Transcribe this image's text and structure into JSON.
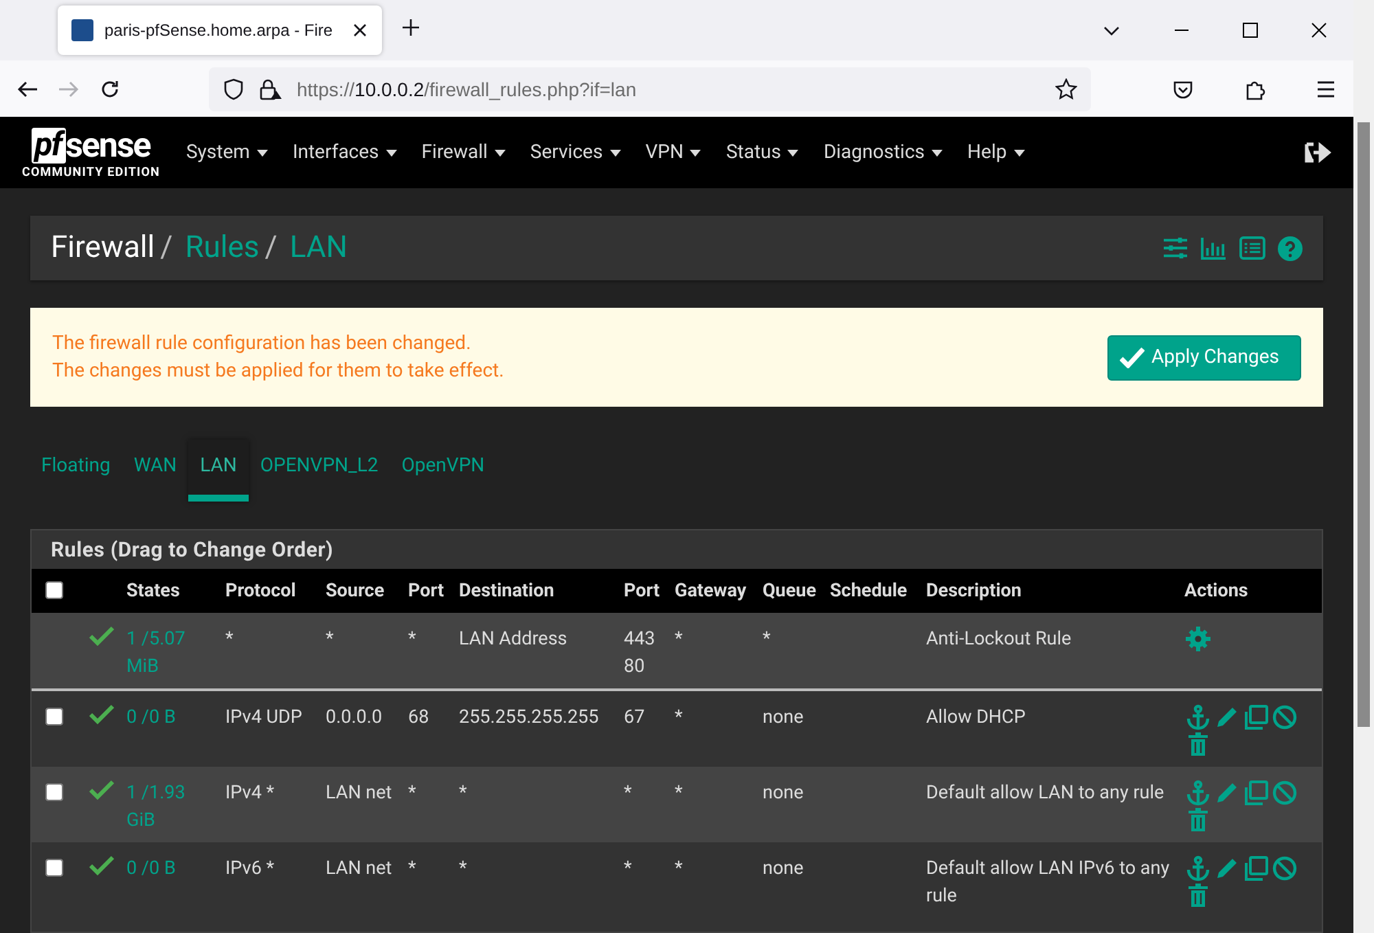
{
  "browser": {
    "tab_title": "paris-pfSense.home.arpa - Fire",
    "url": {
      "scheme": "https://",
      "host": "10.0.0.2",
      "path": "/firewall_rules.php?if=lan"
    }
  },
  "navbar": {
    "logo": {
      "mark": "pf",
      "name": "sense",
      "edition": "COMMUNITY EDITION"
    },
    "menu": [
      "System",
      "Interfaces",
      "Firewall",
      "Services",
      "VPN",
      "Status",
      "Diagnostics",
      "Help"
    ]
  },
  "breadcrumb": {
    "separator": "/",
    "items": [
      "Firewall",
      "Rules",
      "LAN"
    ]
  },
  "alert": {
    "lines": [
      "The firewall rule configuration has been changed.",
      "The changes must be applied for them to take effect."
    ],
    "button": "Apply Changes"
  },
  "tabs": [
    {
      "label": "Floating",
      "selected": false
    },
    {
      "label": "WAN",
      "selected": false
    },
    {
      "label": "LAN",
      "selected": true
    },
    {
      "label": "OPENVPN_L2",
      "selected": false
    },
    {
      "label": "OpenVPN",
      "selected": false
    }
  ],
  "rules": {
    "title": "Rules (Drag to Change Order)",
    "select_all_checked": false,
    "columns": [
      "States",
      "Protocol",
      "Source",
      "Port",
      "Destination",
      "Port",
      "Gateway",
      "Queue",
      "Schedule",
      "Description",
      "Actions"
    ],
    "rows": [
      {
        "kind": "fixed",
        "enabled": true,
        "states": "1 /5.07 MiB",
        "protocol": "*",
        "source": "*",
        "source_port": "*",
        "destination": "LAN Address",
        "destination_port": "443 80",
        "gateway": "*",
        "queue": "*",
        "schedule": "",
        "description": "Anti-Lockout Rule"
      },
      {
        "kind": "rule",
        "checked": false,
        "enabled": true,
        "states": "0 /0 B",
        "protocol": "IPv4 UDP",
        "source": "0.0.0.0",
        "source_port": "68",
        "destination": "255.255.255.255",
        "destination_port": "67",
        "gateway": "*",
        "queue": "none",
        "description": "Allow DHCP"
      },
      {
        "kind": "rule",
        "checked": false,
        "enabled": true,
        "states": "1 /1.93 GiB",
        "protocol": "IPv4 *",
        "source": "LAN net",
        "source_port": "*",
        "destination": "*",
        "destination_port": "*",
        "gateway": "*",
        "queue": "none",
        "description": "Default allow LAN to any rule"
      },
      {
        "kind": "rule",
        "checked": false,
        "enabled": true,
        "states": "0 /0 B",
        "protocol": "IPv6 *",
        "source": "LAN net",
        "source_port": "*",
        "destination": "*",
        "destination_port": "*",
        "gateway": "*",
        "queue": "none",
        "description": "Default allow LAN IPv6 to any rule"
      }
    ]
  }
}
